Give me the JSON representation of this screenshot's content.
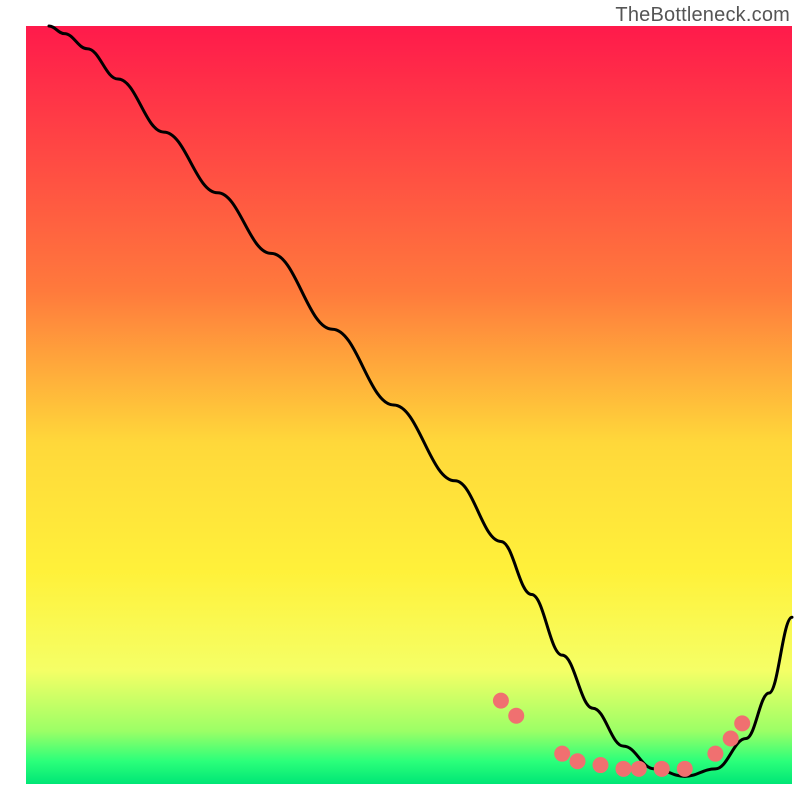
{
  "attribution": "TheBottleneck.com",
  "chart_data": {
    "type": "line",
    "title": "",
    "xlabel": "",
    "ylabel": "",
    "xlim": [
      0,
      100
    ],
    "ylim": [
      0,
      100
    ],
    "grid": false,
    "legend": false,
    "background": {
      "type": "vertical-gradient",
      "stops": [
        {
          "offset": 0.0,
          "color": "#ff1a4b"
        },
        {
          "offset": 0.35,
          "color": "#ff7a3c"
        },
        {
          "offset": 0.55,
          "color": "#ffd83a"
        },
        {
          "offset": 0.72,
          "color": "#fff13a"
        },
        {
          "offset": 0.85,
          "color": "#f5ff66"
        },
        {
          "offset": 0.93,
          "color": "#9cff66"
        },
        {
          "offset": 0.97,
          "color": "#2bff7a"
        },
        {
          "offset": 1.0,
          "color": "#00e676"
        }
      ]
    },
    "series": [
      {
        "name": "bottleneck-curve",
        "color": "#000000",
        "x": [
          3,
          5,
          8,
          12,
          18,
          25,
          32,
          40,
          48,
          56,
          62,
          66,
          70,
          74,
          78,
          82,
          86,
          90,
          94,
          97,
          100
        ],
        "y": [
          100,
          99,
          97,
          93,
          86,
          78,
          70,
          60,
          50,
          40,
          32,
          25,
          17,
          10,
          5,
          2,
          1,
          2,
          6,
          12,
          22
        ]
      }
    ],
    "markers": {
      "name": "highlight-dots",
      "color": "#f07070",
      "radius": 8,
      "points": [
        {
          "x": 62,
          "y": 11
        },
        {
          "x": 64,
          "y": 9
        },
        {
          "x": 70,
          "y": 4
        },
        {
          "x": 72,
          "y": 3
        },
        {
          "x": 75,
          "y": 2.5
        },
        {
          "x": 78,
          "y": 2
        },
        {
          "x": 80,
          "y": 2
        },
        {
          "x": 83,
          "y": 2
        },
        {
          "x": 86,
          "y": 2
        },
        {
          "x": 90,
          "y": 4
        },
        {
          "x": 92,
          "y": 6
        },
        {
          "x": 93.5,
          "y": 8
        }
      ]
    }
  }
}
